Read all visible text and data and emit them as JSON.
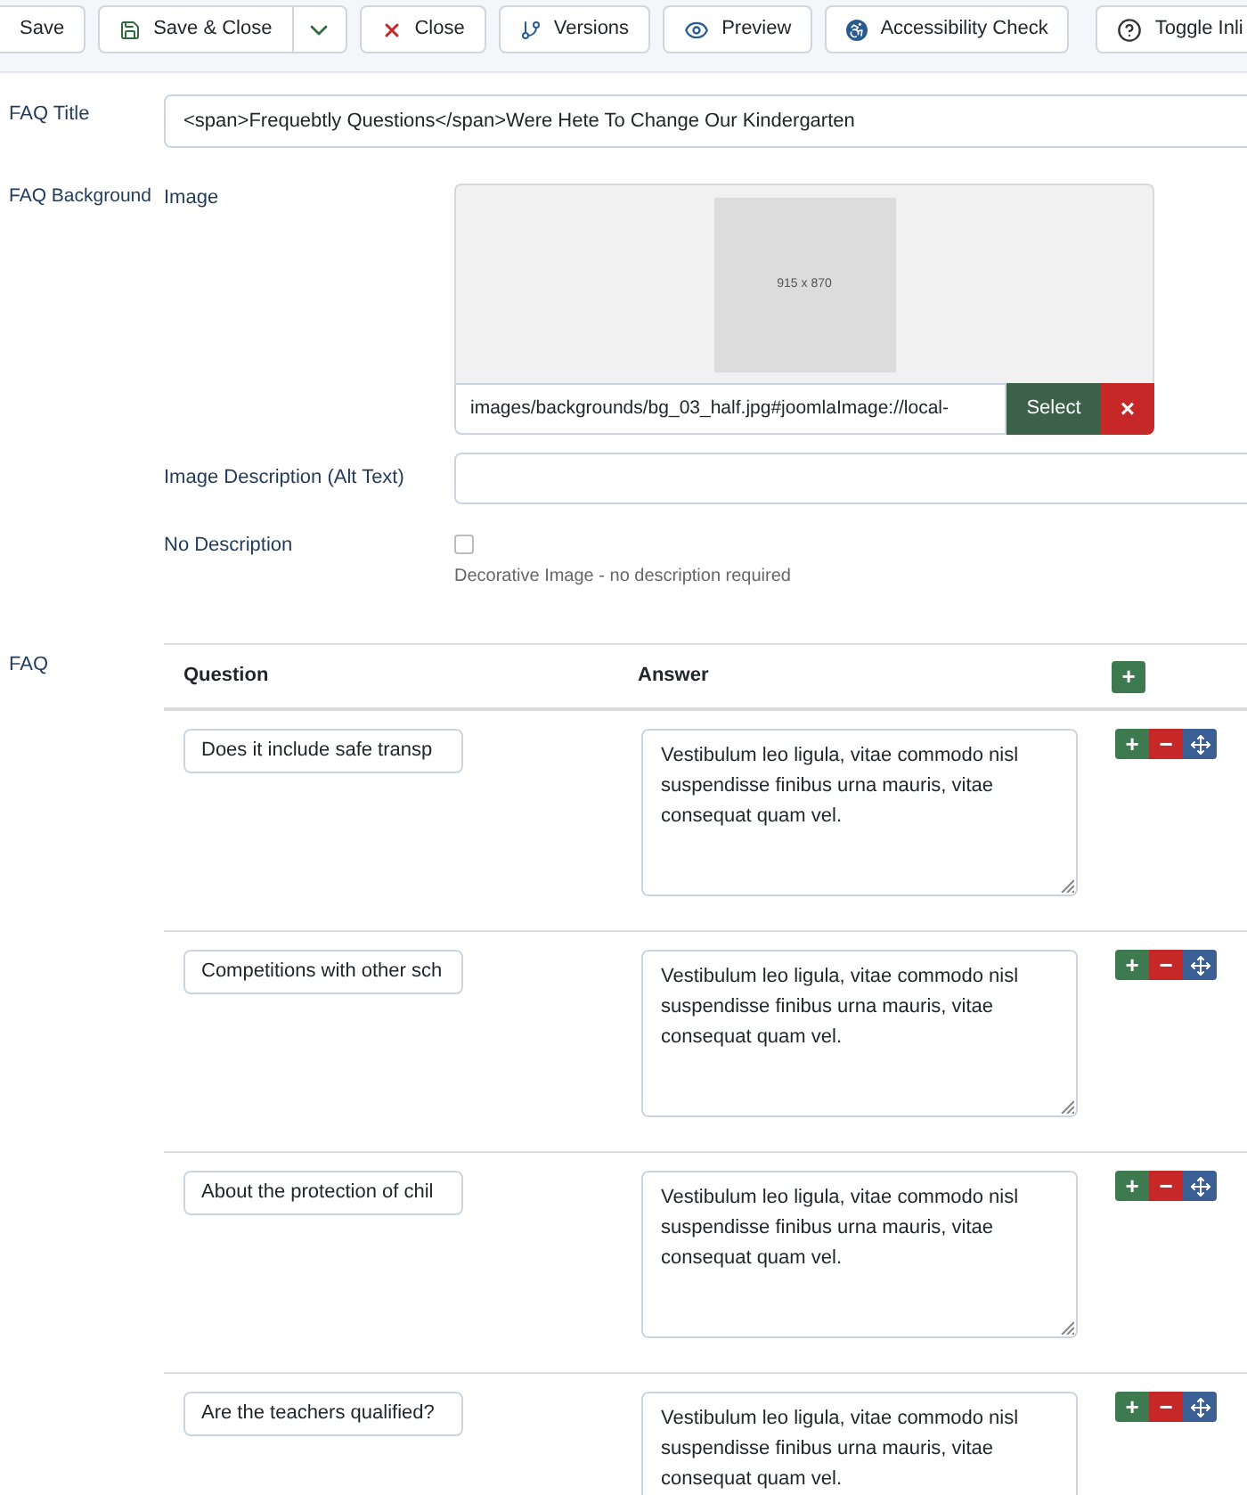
{
  "toolbar": [
    {
      "label": "Save",
      "kind": "plain"
    },
    {
      "label": "Save & Close",
      "kind": "split"
    },
    {
      "label": "Close",
      "kind": "close"
    },
    {
      "label": "Versions",
      "kind": "versions"
    },
    {
      "label": "Preview",
      "kind": "preview"
    },
    {
      "label": "Accessibility Check",
      "kind": "access"
    },
    {
      "label": "Toggle Inli",
      "kind": "help"
    }
  ],
  "faq_title": {
    "label": "FAQ Title",
    "value": "<span>Frequebtly Questions</span>Were Hete To Change Our Kindergarten"
  },
  "faq_background": {
    "label": "FAQ Background",
    "image_label": "Image",
    "preview_text": "915 x 870",
    "path": "images/backgrounds/bg_03_half.jpg#joomlaImage://local-",
    "select": "Select",
    "clear": "×",
    "alt_label": "Image Description (Alt Text)",
    "no_desc_label": "No Description",
    "no_desc_checked": false,
    "no_desc_hint": "Decorative Image - no description required"
  },
  "faq": {
    "label": "FAQ",
    "columns": [
      "Question",
      "Answer"
    ],
    "add": "+",
    "rows": [
      {
        "question": "Does it include safe transp",
        "answer": "Vestibulum leo ligula, vitae commodo nisl suspendisse finibus urna mauris, vitae consequat quam vel."
      },
      {
        "question": "Competitions with other sch",
        "answer": "Vestibulum leo ligula, vitae commodo nisl suspendisse finibus urna mauris, vitae consequat quam vel."
      },
      {
        "question": "About the protection of chil",
        "answer": "Vestibulum leo ligula, vitae commodo nisl suspendisse finibus urna mauris, vitae consequat quam vel."
      },
      {
        "question": "Are the teachers qualified?",
        "answer": "Vestibulum leo ligula, vitae commodo nisl suspendisse finibus urna mauris, vitae consequat quam vel."
      }
    ],
    "row_add": "+",
    "row_remove": "−"
  }
}
